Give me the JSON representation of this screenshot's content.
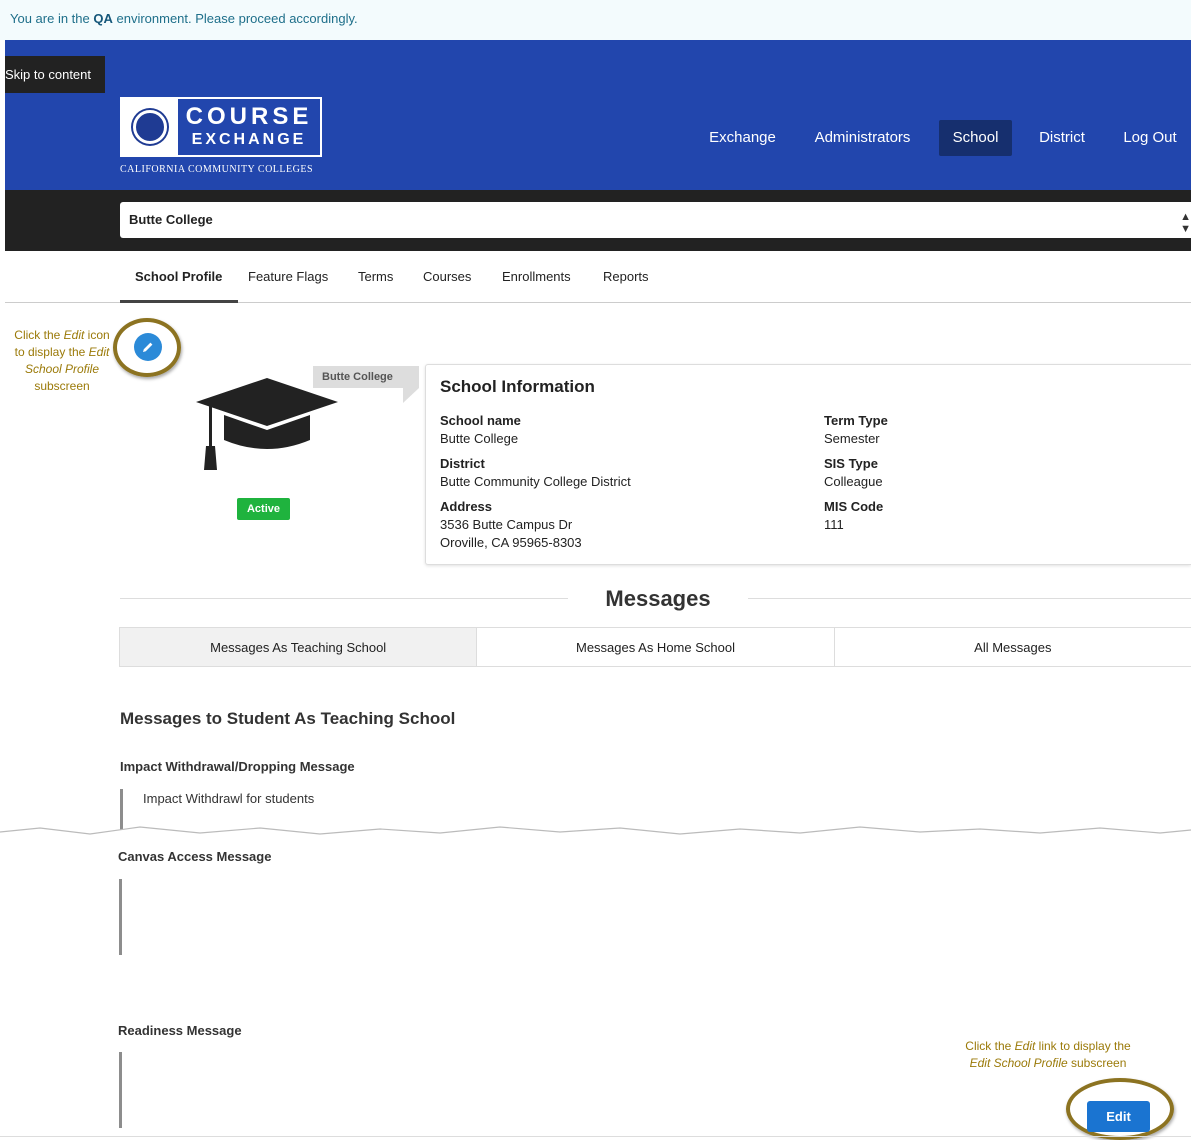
{
  "qa_banner": {
    "prefix": "You are in the ",
    "env": "QA",
    "suffix": " environment. Please proceed accordingly."
  },
  "header": {
    "skip_link": "Skip to content",
    "logo": {
      "line1": "COURSE",
      "line2": "EXCHANGE",
      "subtitle": "CALIFORNIA COMMUNITY COLLEGES"
    },
    "nav": [
      {
        "label": "Exchange",
        "active": false
      },
      {
        "label": "Administrators",
        "active": false
      },
      {
        "label": "School",
        "active": true
      },
      {
        "label": "District",
        "active": false
      },
      {
        "label": "Log Out",
        "active": false
      }
    ]
  },
  "school_select": {
    "value": "Butte College"
  },
  "tabs": [
    {
      "label": "School Profile",
      "active": true
    },
    {
      "label": "Feature Flags",
      "active": false
    },
    {
      "label": "Terms",
      "active": false
    },
    {
      "label": "Courses",
      "active": false
    },
    {
      "label": "Enrollments",
      "active": false
    },
    {
      "label": "Reports",
      "active": false
    }
  ],
  "annotations": {
    "left": {
      "t1": "Click the ",
      "t2": "Edit",
      "t3": " icon to display the ",
      "t4": "Edit School Profile",
      "t5": " subscreen"
    },
    "right": {
      "t1": "Click the ",
      "t2": "Edit",
      "t3": "  link to display the ",
      "t4": "Edit School Profile",
      "t5": " subscreen"
    }
  },
  "profile": {
    "name_tag": "Butte College",
    "status": "Active",
    "status_color": "#1fb33e",
    "icon": "graduation-cap-icon"
  },
  "info": {
    "title": "School Information",
    "school_name": {
      "label": "School name",
      "value": "Butte College"
    },
    "district": {
      "label": "District",
      "value": "Butte Community College District"
    },
    "address": {
      "label": "Address",
      "line1": "3536 Butte Campus Dr",
      "line2": "Oroville, CA 95965-8303"
    },
    "term_type": {
      "label": "Term Type",
      "value": "Semester"
    },
    "sis_type": {
      "label": "SIS Type",
      "value": "Colleague"
    },
    "mis_code": {
      "label": "MIS Code",
      "value": "111"
    }
  },
  "messages": {
    "heading": "Messages",
    "tabs": [
      {
        "label": "Messages As Teaching School",
        "active": true
      },
      {
        "label": "Messages As Home School",
        "active": false
      },
      {
        "label": "All Messages",
        "active": false
      }
    ],
    "section_title": "Messages to Student As Teaching School",
    "items": [
      {
        "label": "Impact Withdrawal/Dropping Message",
        "text": "Impact Withdrawl for students"
      },
      {
        "label": "Canvas Access Message",
        "text": ""
      },
      {
        "label": "Readiness Message",
        "text": ""
      }
    ],
    "edit_label": "Edit"
  },
  "colors": {
    "header_blue": "#2246ad",
    "accent_gold": "#8c7321",
    "button_blue": "#1a74d1"
  }
}
